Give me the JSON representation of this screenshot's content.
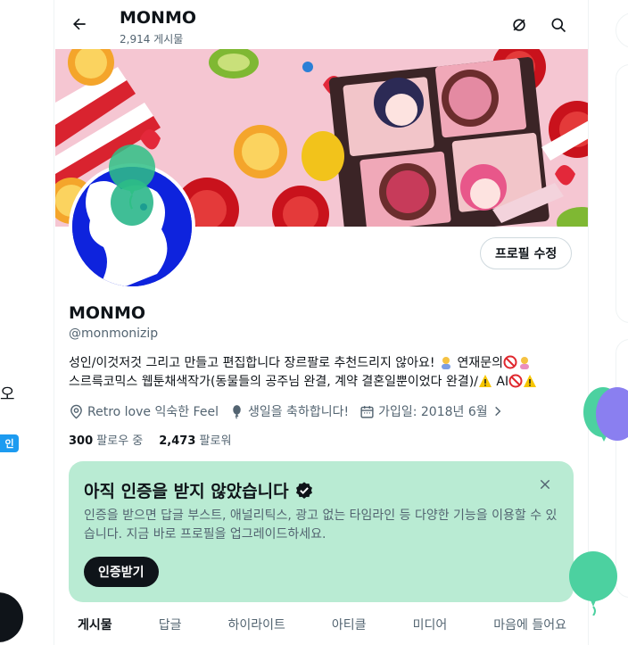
{
  "header": {
    "title": "MONMO",
    "post_count": "2,914 게시물"
  },
  "profile": {
    "edit_label": "프로필 수정",
    "name": "MONMO",
    "handle": "@monmonizip",
    "bio_line1_a": "성인/이것저것 그리고 만들고 편집합니다 장르팔로 추천드리지 않아요! ",
    "bio_line1_b": " 연재문의",
    "bio_line2_a": "스르륵코믹스 웹툰채색작가(동물들의 공주님 완결, 계약 결혼일뿐이었다 완결)/",
    "bio_line2_b": " AI",
    "location": "Retro love 익숙한 Feel",
    "birthday": "생일을 축하합니다!",
    "joined": "가입일: 2018년 6월",
    "following_count": "300",
    "following_label": "팔로우 중",
    "followers_count": "2,473",
    "followers_label": "팔로워"
  },
  "verify": {
    "title": "아직 인증을 받지 않았습니다",
    "description": "인증을 받으면 답글 부스트, 애널리틱스, 광고 없는 타임라인 등 다양한 기능을 이용할 수 있습니다. 지금 바로 프로필을 업그레이드하세요.",
    "button": "인증받기"
  },
  "tabs": [
    {
      "label": "게시물"
    },
    {
      "label": "답글"
    },
    {
      "label": "하이라이트"
    },
    {
      "label": "아티클"
    },
    {
      "label": "미디어"
    },
    {
      "label": "마음에 들어요"
    }
  ],
  "left_fragment": {
    "text": "오",
    "badge": "인"
  },
  "colors": {
    "verify_bg": "#b9ebd3",
    "accent": "#1d9bf0",
    "avatar_bg": "#0e23dd",
    "balloon_green": "#4cd1a0",
    "balloon_purple": "#8a7ff0"
  },
  "icons": {
    "back": "arrow-left-icon",
    "search": "search-icon",
    "no_notify": "bell-off-icon",
    "location": "location-pin-icon",
    "birthday": "balloon-icon",
    "calendar": "calendar-icon",
    "verified": "verified-badge-icon",
    "close": "close-icon"
  }
}
